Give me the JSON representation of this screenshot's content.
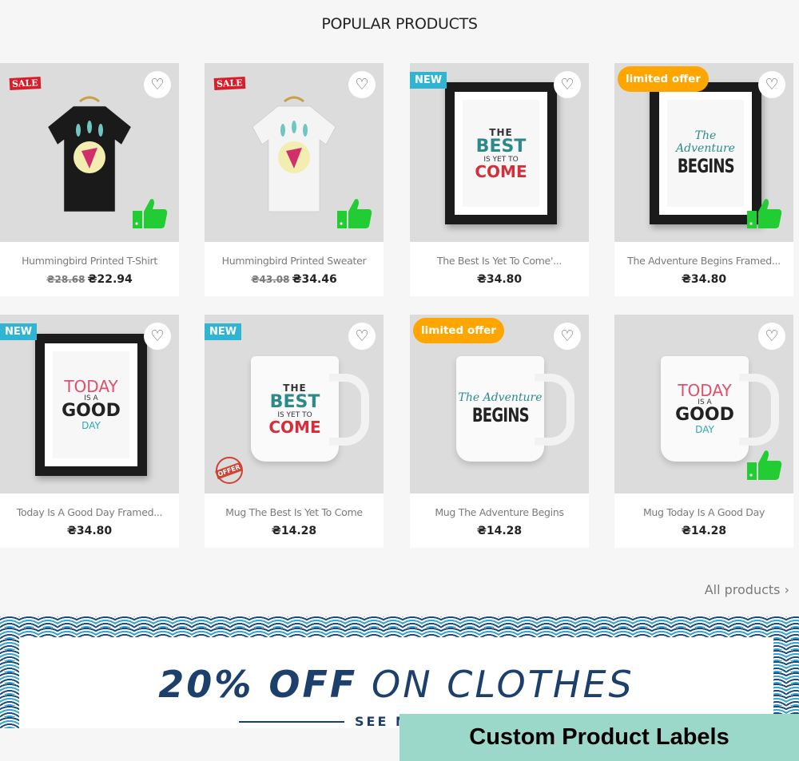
{
  "section_title": "POPULAR PRODUCTS",
  "products": [
    {
      "name": "Hummingbird Printed T-Shirt",
      "old_price": "₴28.68",
      "price": "₴22.94",
      "badge": "SALE",
      "badge_type": "sale",
      "thumb": true,
      "image": "tshirt-black"
    },
    {
      "name": "Hummingbird Printed Sweater",
      "old_price": "₴43.08",
      "price": "₴34.46",
      "badge": "SALE",
      "badge_type": "sale",
      "thumb": true,
      "image": "sweater-white"
    },
    {
      "name": "The Best Is Yet To Come'...",
      "price": "₴34.80",
      "badge": "NEW",
      "badge_type": "new",
      "thumb": false,
      "image": "frame-best",
      "poster": [
        "THE",
        "BEST",
        "IS YET TO",
        "COME"
      ]
    },
    {
      "name": "The Adventure Begins Framed...",
      "price": "₴34.80",
      "badge": "limited offer",
      "badge_type": "limited",
      "thumb": true,
      "image": "frame-adventure",
      "poster": [
        "The Adventure",
        "BEGINS"
      ]
    },
    {
      "name": "Today Is A Good Day Framed...",
      "price": "₴34.80",
      "badge": "NEW",
      "badge_type": "new",
      "thumb": false,
      "image": "frame-today",
      "poster": [
        "TODAY",
        "IS A",
        "GOOD",
        "DAY"
      ]
    },
    {
      "name": "Mug The Best Is Yet To Come",
      "price": "₴14.28",
      "badge": "NEW",
      "badge_type": "new",
      "thumb": false,
      "stamp": "OFFER",
      "image": "mug-best",
      "poster": [
        "THE",
        "BEST",
        "IS YET TO",
        "COME"
      ]
    },
    {
      "name": "Mug The Adventure Begins",
      "price": "₴14.28",
      "badge": "limited offer",
      "badge_type": "limited",
      "thumb": false,
      "image": "mug-adventure",
      "poster": [
        "The Adventure",
        "BEGINS"
      ]
    },
    {
      "name": "Mug Today Is A Good Day",
      "price": "₴14.28",
      "thumb": true,
      "image": "mug-today",
      "poster": [
        "TODAY",
        "IS A",
        "GOOD",
        "DAY"
      ]
    }
  ],
  "all_products_link": "All products",
  "banner": {
    "bold": "20% OFF",
    "rest": " ON CLOTHES",
    "cta": "SEE M"
  },
  "overlay_label": "Custom Product Labels",
  "colors": {
    "new": "#2fb5d2",
    "limited": "#ffa500",
    "sale": "#d81e2a",
    "thumb": "#22cc33",
    "overlay": "#9bd8c9",
    "banner_text": "#1c3f6c"
  }
}
